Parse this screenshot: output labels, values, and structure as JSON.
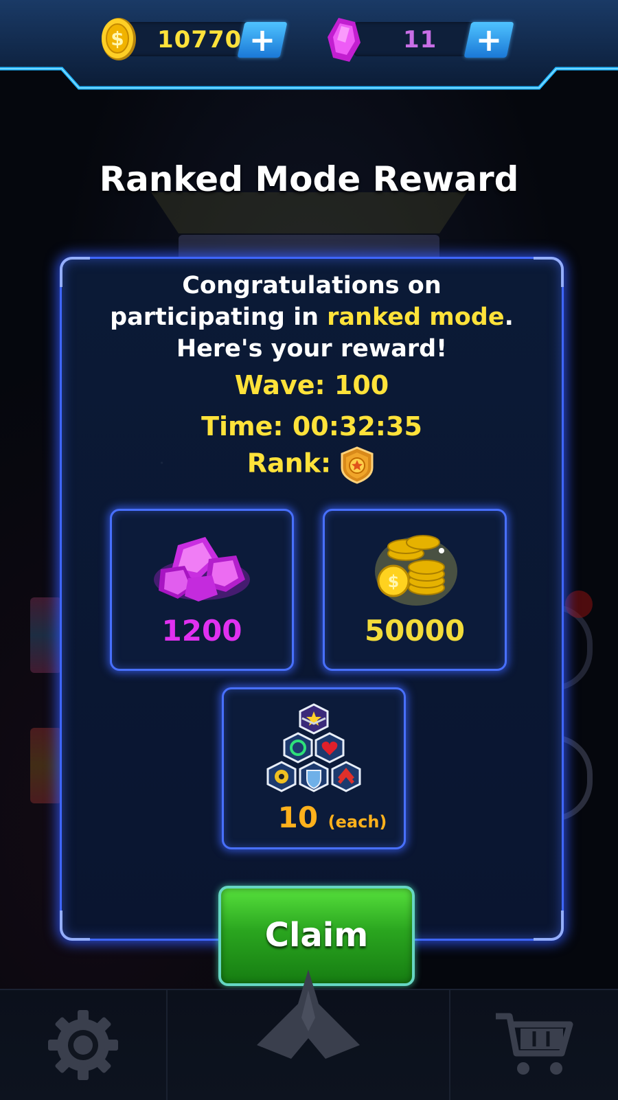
{
  "header": {
    "coins": "10770",
    "gems": "11",
    "coins_plus_label": "+",
    "gems_plus_label": "+"
  },
  "title": "Ranked Mode Reward",
  "message": {
    "line1": "Congratulations on",
    "line2_prefix": "participating in ",
    "line2_highlight": "ranked mode",
    "line2_suffix": ".",
    "line3": "Here's your reward!"
  },
  "stats": {
    "wave": "Wave: 100",
    "time": "Time: 00:32:35",
    "rank_label": "Rank:",
    "rank_icon": "rank-medal-icon"
  },
  "rewards": [
    {
      "icon": "gems-pile-icon",
      "value": "1200",
      "color": "#e030f0"
    },
    {
      "icon": "coins-stack-icon",
      "value": "50000",
      "color": "#f2dc3a"
    },
    {
      "icon": "powerups-hex-icon",
      "value": "10",
      "suffix": "(each)",
      "color": "#ffb11c"
    }
  ],
  "claim_label": "Claim",
  "nav": {
    "items": [
      "settings-gear-icon",
      "spaceship-icon",
      "shop-cart-icon"
    ]
  },
  "colors": {
    "accent": "#3f66ff",
    "highlight": "#ffe23a",
    "claim": "#2aa51f"
  }
}
